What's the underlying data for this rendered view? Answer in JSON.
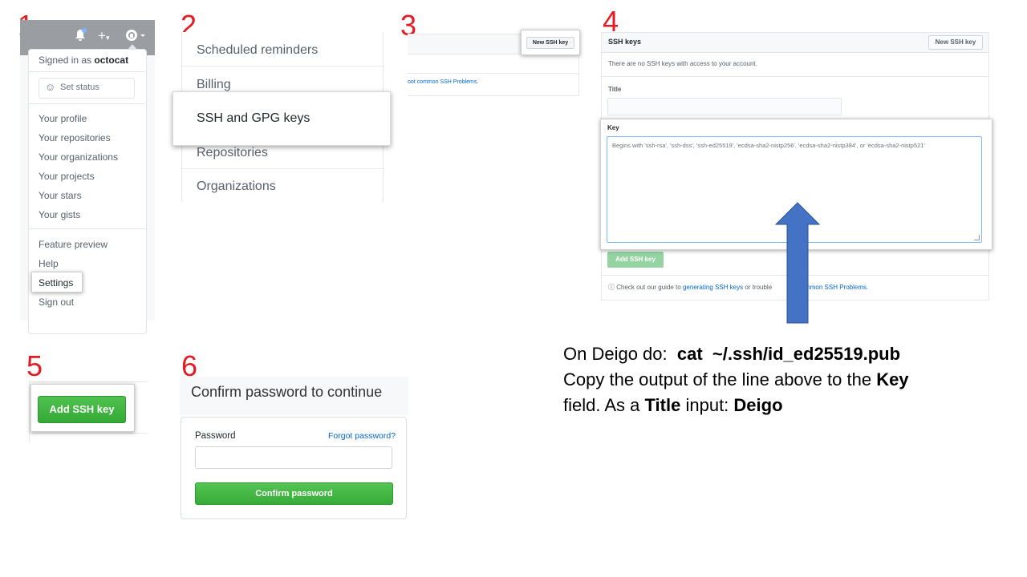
{
  "steps": [
    "1",
    "2",
    "3",
    "4",
    "5",
    "6"
  ],
  "panel1": {
    "signed_prefix": "Signed in as",
    "username": "octocat",
    "set_status": "Set status",
    "menu_group1": [
      "Your profile",
      "Your repositories",
      "Your organizations",
      "Your projects",
      "Your stars",
      "Your gists"
    ],
    "feature_preview": "Feature preview",
    "help": "Help",
    "settings": "Settings",
    "sign_out": "Sign out",
    "header_icons": [
      "bell-icon",
      "plus-icon",
      "avatar-icon"
    ]
  },
  "panel2": {
    "items": [
      "Scheduled reminders",
      "Billing",
      "SSH and GPG keys",
      "Repositories",
      "Organizations"
    ]
  },
  "panel3": {
    "new_ssh_key": "New SSH key",
    "link_fragment": "oot common SSH Problems."
  },
  "panel4": {
    "header_title": "SSH keys",
    "new_ssh_key": "New SSH key",
    "empty_text": "There are no SSH keys with access to your account.",
    "title_label": "Title",
    "key_label": "Key",
    "key_placeholder": "Begins with 'ssh-rsa', 'ssh-dss', 'ssh-ed25519', 'ecdsa-sha2-nistp256', 'ecdsa-sha2-nistp384', or 'ecdsa-sha2-nistp521'",
    "add_button": "Add SSH key",
    "footer_prefix": "Check out our guide to",
    "footer_link1": "generating SSH keys",
    "footer_mid": "or trouble",
    "footer_link2": "common SSH Problems.",
    "arrow_color": "#4472c4"
  },
  "panel5": {
    "add_button": "Add SSH key"
  },
  "panel6": {
    "heading": "Confirm password to continue",
    "password_label": "Password",
    "forgot_link": "Forgot password?",
    "confirm_button": "Confirm password"
  },
  "instructions": {
    "line1_prefix": "On Deigo do:",
    "command": "cat  ~/.ssh/id_ed25519.pub",
    "line2_prefix": "Copy the output of the line above to the",
    "key_word": "Key",
    "line3_prefix": "field. As a",
    "title_word": "Title",
    "line3_mid": "input:",
    "deigo_word": "Deigo"
  }
}
